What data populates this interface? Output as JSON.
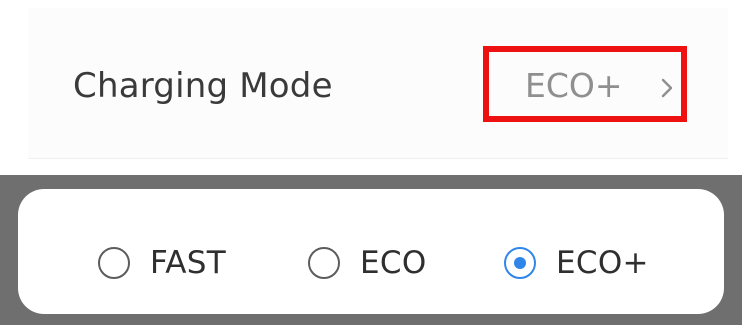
{
  "setting_row": {
    "label": "Charging Mode",
    "value": "ECO+",
    "chevron_icon": "chevron-right-icon",
    "highlight_color": "#ee1111"
  },
  "mode_selector": {
    "options": [
      {
        "label": "FAST",
        "selected": false
      },
      {
        "label": "ECO",
        "selected": false
      },
      {
        "label": "ECO+",
        "selected": true
      }
    ],
    "accent_color": "#2f86e8"
  }
}
